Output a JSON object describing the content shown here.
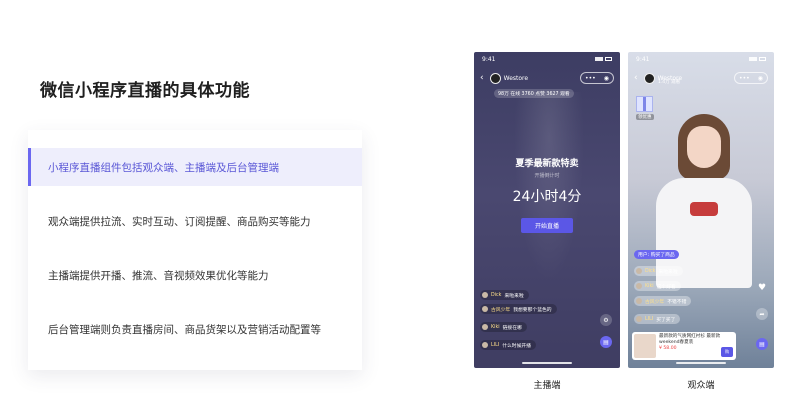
{
  "page": {
    "title": "微信小程序直播的具体功能"
  },
  "features": [
    {
      "text": "小程序直播组件包括观众端、主播端及后台管理端",
      "active": true
    },
    {
      "text": "观众端提供拉流、实时互动、订阅提醒、商品购买等能力",
      "active": false
    },
    {
      "text": "主播端提供开播、推流、音视频效果优化等能力",
      "active": false
    },
    {
      "text": "后台管理端则负责直播房间、商品货架以及营销活动配置等",
      "active": false
    }
  ],
  "host_phone": {
    "caption": "主播端",
    "time": "9:41",
    "room_name": "Westore",
    "stats": "98万 在线  3760 点赞  3627 观看",
    "title": "夏季最新款特卖",
    "countdown_label": "开播倒计时",
    "countdown": "24小时4分",
    "start_button": "开始直播",
    "comments": [
      {
        "name": "Dick",
        "text": "来啦来啦"
      },
      {
        "name": "古风少年",
        "text": "我想要那个蓝色的"
      },
      {
        "name": "Kiki",
        "text": "链接在哪"
      },
      {
        "name": "LILI",
        "text": "什么时候开播"
      }
    ]
  },
  "viewer_phone": {
    "caption": "观众端",
    "time": "9:41",
    "room_name": "Westore",
    "sub": "1.4万 观看",
    "gift_label": "领优惠",
    "notice": "用户: 购买了商品",
    "comments": [
      {
        "name": "Dick",
        "text": "来啦来啦"
      },
      {
        "name": "Kiki",
        "text": "这个好看"
      },
      {
        "name": "古风少年",
        "text": "不错不错"
      },
      {
        "name": "LILI",
        "text": "买了买了"
      }
    ],
    "product": {
      "title": "最新款的气质网红衬衫 最新款weekend春夏装",
      "price": "¥ 58.00",
      "buy": "购"
    }
  },
  "colors": {
    "accent": "#6b67f0",
    "active_bg": "#eeeefc",
    "host_bg": "#3d3d63"
  }
}
